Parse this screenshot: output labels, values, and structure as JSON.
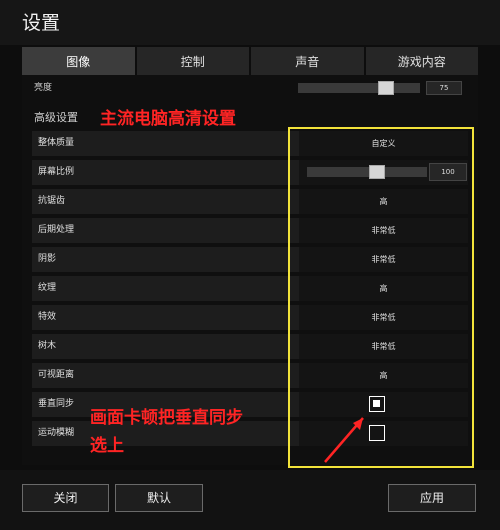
{
  "window": {
    "title": "设置"
  },
  "tabs": [
    {
      "label": "图像",
      "active": true
    },
    {
      "label": "控制",
      "active": false
    },
    {
      "label": "声音",
      "active": false
    },
    {
      "label": "游戏内容",
      "active": false
    }
  ],
  "brightness": {
    "label": "亮度",
    "value": "75",
    "level": 0.75
  },
  "section": {
    "title": "高级设置"
  },
  "rows": [
    {
      "label": "整体质量",
      "value": "自定义"
    },
    {
      "label": "屏幕比例",
      "value": "100",
      "level": 0.6
    },
    {
      "label": "抗锯齿",
      "value": "高"
    },
    {
      "label": "后期处理",
      "value": "非常低"
    },
    {
      "label": "阴影",
      "value": "非常低"
    },
    {
      "label": "纹理",
      "value": "高"
    },
    {
      "label": "特效",
      "value": "非常低"
    },
    {
      "label": "树木",
      "value": "非常低"
    },
    {
      "label": "可视距离",
      "value": "高"
    },
    {
      "label": "垂直同步",
      "checked": true
    },
    {
      "label": "运动模糊",
      "checked": false
    }
  ],
  "annotations": {
    "header": "主流电脑高清设置",
    "note_line1": "画面卡顿把垂直同步",
    "note_line2": "选上"
  },
  "buttons": {
    "close": "关闭",
    "default": "默认",
    "apply": "应用"
  },
  "colors": {
    "highlight": "#f2e33a",
    "annotation": "#ff2424"
  }
}
